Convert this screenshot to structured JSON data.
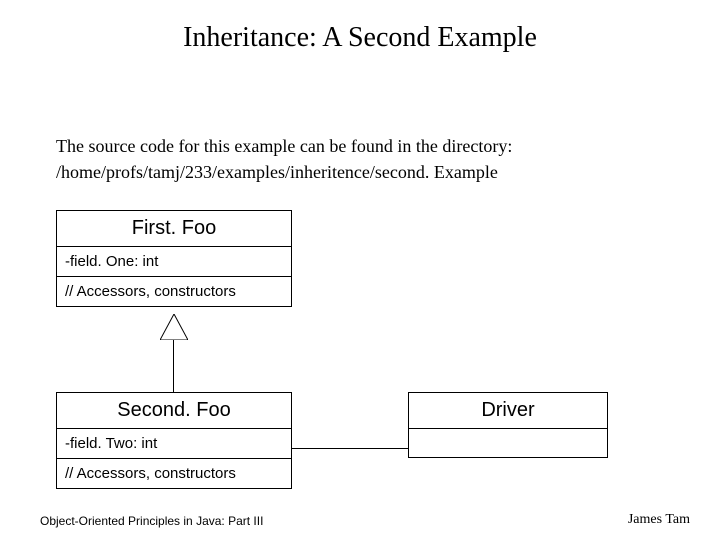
{
  "title": "Inheritance: A Second Example",
  "intro": {
    "line1": "The source code for this example can be found in the directory:",
    "line2": "/home/profs/tamj/233/examples/inheritence/second. Example"
  },
  "classes": {
    "firstFoo": {
      "name": "First. Foo",
      "attrs": "-field. One: int",
      "ops": "// Accessors, constructors"
    },
    "secondFoo": {
      "name": "Second. Foo",
      "attrs": "-field. Two: int",
      "ops": "// Accessors, constructors"
    },
    "driver": {
      "name": "Driver"
    }
  },
  "footer": {
    "left": "Object-Oriented Principles in Java: Part III",
    "right": "James Tam"
  }
}
